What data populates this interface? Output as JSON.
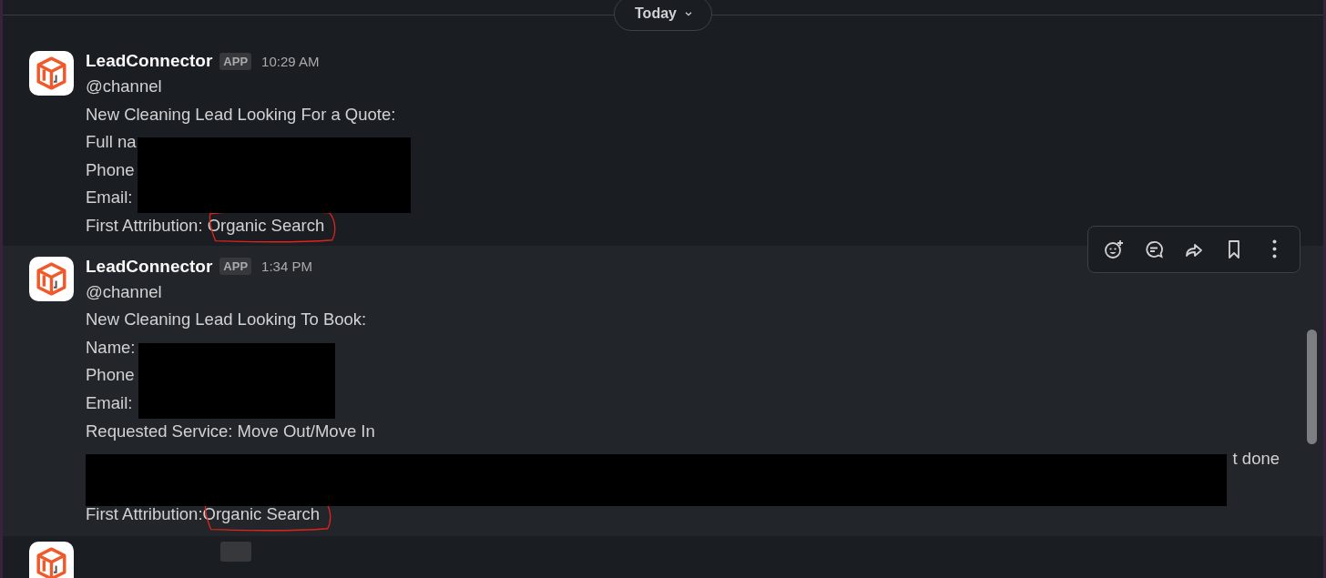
{
  "day_divider": {
    "label": "Today"
  },
  "messages": [
    {
      "kind": "full",
      "hovered": false,
      "sender": "LeadConnector",
      "badge": "APP",
      "time": "10:29 AM",
      "lines": [
        {
          "text": "@channel"
        },
        {
          "text": "New Cleaning Lead Looking For a Quote:"
        },
        {
          "text": "Full na",
          "redacted": true
        },
        {
          "text": "Phone",
          "redacted": true
        },
        {
          "text": "Email:",
          "redacted": true
        },
        {
          "text": "First Attribution: ",
          "circled": "Organic Search"
        }
      ]
    },
    {
      "kind": "full",
      "hovered": true,
      "sender": "LeadConnector",
      "badge": "APP",
      "time": "1:34 PM",
      "lines": [
        {
          "text": "@channel"
        },
        {
          "text": "New Cleaning Lead Looking To Book:"
        },
        {
          "text": "Name:",
          "redacted": true
        },
        {
          "text": "Phone",
          "redacted": true
        },
        {
          "text": "Email:",
          "redacted": true
        },
        {
          "text": "Requested Service: Move Out/Move In"
        },
        {
          "kind": "right_aligned",
          "text": "t done",
          "redacted": true
        },
        {
          "redacted": true
        },
        {
          "text": "First Attribution:",
          "circled": "Organic Search"
        }
      ]
    },
    {
      "kind": "cut_off"
    }
  ]
}
